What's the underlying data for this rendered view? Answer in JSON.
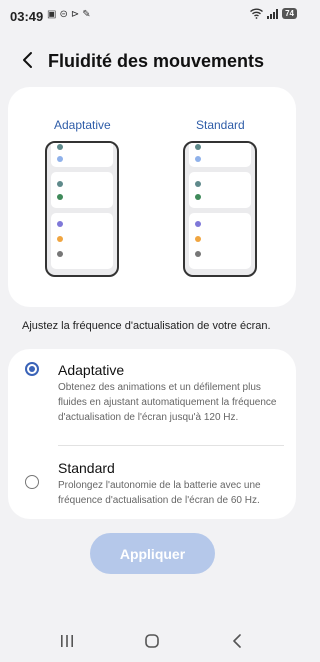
{
  "status_bar": {
    "time": "03:49",
    "battery": "74"
  },
  "header": {
    "title": "Fluidité des mouvements"
  },
  "preview": {
    "left_label": "Adaptative",
    "right_label": "Standard"
  },
  "description": "Ajustez la fréquence d'actualisation de votre écran.",
  "options": [
    {
      "title": "Adaptative",
      "description": "Obtenez des animations et un défilement plus fluides en ajustant automatiquement la fréquence d'actualisation de l'écran jusqu'à 120 Hz.",
      "selected": true
    },
    {
      "title": "Standard",
      "description": "Prolongez l'autonomie de la batterie avec une fréquence d'actualisation de l'écran de 60 Hz.",
      "selected": false
    }
  ],
  "apply_button": "Appliquer",
  "colors": {
    "accent": "#3a63b8",
    "apply_disabled": "#b5c8ea",
    "dot_teal": "#5f8a8b",
    "dot_blue": "#8fb1ea",
    "dot_green": "#3f8a5a",
    "dot_purple": "#7f78d8",
    "dot_orange": "#f0a540",
    "dot_gray": "#777777"
  },
  "icons": {
    "back": "chevron-left-icon",
    "nav_recents": "recents-icon",
    "nav_home": "home-icon",
    "nav_back": "back-icon"
  }
}
